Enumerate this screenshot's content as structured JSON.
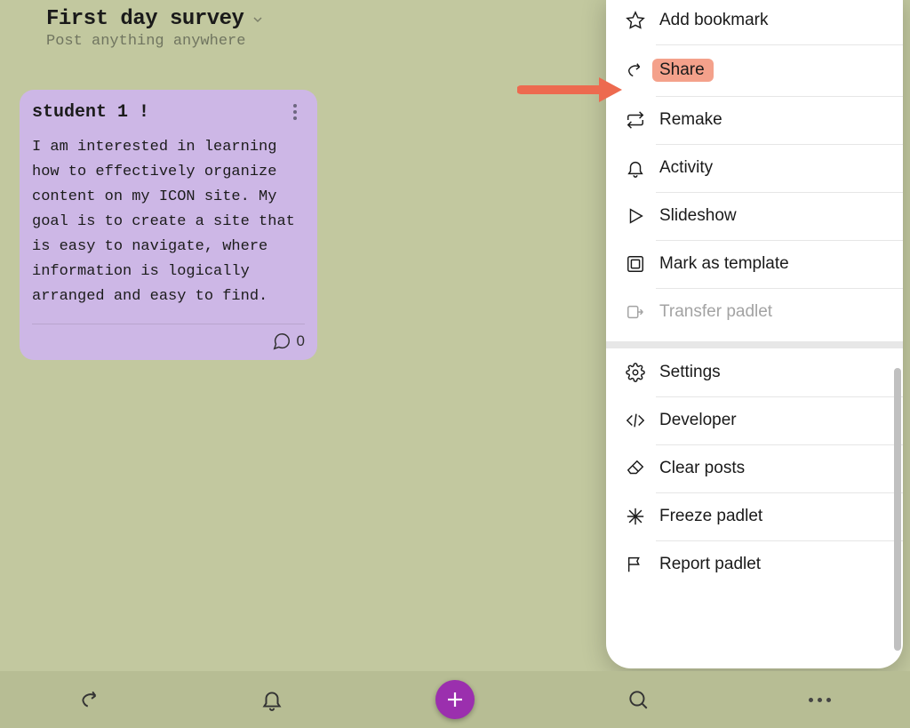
{
  "header": {
    "title": "First day survey",
    "subtitle": "Post anything anywhere"
  },
  "card": {
    "title": "student 1 !",
    "body": "I am interested in learning how to effectively organize content on my ICON site. My goal is to create a site that is easy to navigate, where information is logically arranged and easy to find.",
    "comments": "0"
  },
  "menu": {
    "group1": [
      {
        "icon": "star",
        "label": "Add bookmark",
        "name": "menu-add-bookmark"
      },
      {
        "icon": "share",
        "label": "Share",
        "name": "menu-share",
        "highlight": true
      },
      {
        "icon": "remake",
        "label": "Remake",
        "name": "menu-remake"
      },
      {
        "icon": "bell",
        "label": "Activity",
        "name": "menu-activity"
      },
      {
        "icon": "play",
        "label": "Slideshow",
        "name": "menu-slideshow"
      },
      {
        "icon": "template",
        "label": "Mark as template",
        "name": "menu-mark-template"
      },
      {
        "icon": "transfer",
        "label": "Transfer padlet",
        "name": "menu-transfer",
        "disabled": true
      }
    ],
    "group2": [
      {
        "icon": "gear",
        "label": "Settings",
        "name": "menu-settings"
      },
      {
        "icon": "code",
        "label": "Developer",
        "name": "menu-developer"
      },
      {
        "icon": "erase",
        "label": "Clear posts",
        "name": "menu-clear-posts"
      },
      {
        "icon": "freeze",
        "label": "Freeze padlet",
        "name": "menu-freeze"
      },
      {
        "icon": "flag",
        "label": "Report padlet",
        "name": "menu-report"
      }
    ]
  },
  "colors": {
    "arrow": "#ed6a4f",
    "highlight": "#f4a18b",
    "card": "#cdb7e6",
    "accent": "#9b2fae"
  }
}
